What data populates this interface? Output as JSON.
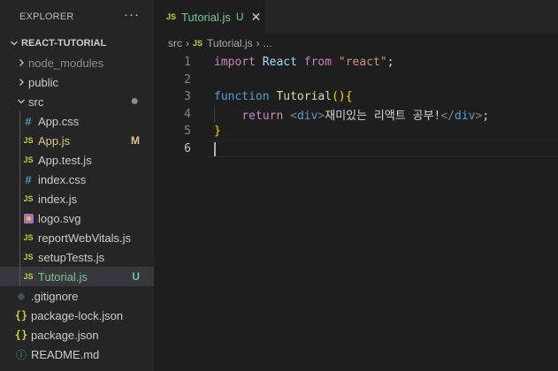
{
  "explorer": {
    "title": "EXPLORER",
    "more": "···",
    "root": "REACT-TUTORIAL",
    "items": [
      {
        "label": "node_modules",
        "kind": "folder",
        "open": false,
        "dim": true,
        "depth": 1
      },
      {
        "label": "public",
        "kind": "folder",
        "open": false,
        "depth": 1
      },
      {
        "label": "src",
        "kind": "folder",
        "open": true,
        "depth": 1,
        "badge": "●",
        "badge_kind": "dot"
      },
      {
        "label": "App.css",
        "kind": "css",
        "depth": 2
      },
      {
        "label": "App.js",
        "kind": "js",
        "depth": 2,
        "status": "mod",
        "badge": "M",
        "badge_kind": "mod"
      },
      {
        "label": "App.test.js",
        "kind": "js",
        "depth": 2
      },
      {
        "label": "index.css",
        "kind": "css",
        "depth": 2
      },
      {
        "label": "index.js",
        "kind": "js",
        "depth": 2
      },
      {
        "label": "logo.svg",
        "kind": "svg",
        "depth": 2
      },
      {
        "label": "reportWebVitals.js",
        "kind": "js",
        "depth": 2
      },
      {
        "label": "setupTests.js",
        "kind": "js",
        "depth": 2
      },
      {
        "label": "Tutorial.js",
        "kind": "js",
        "depth": 2,
        "status": "new",
        "badge": "U",
        "badge_kind": "new",
        "selected": true
      },
      {
        "label": ".gitignore",
        "kind": "git",
        "depth": 1
      },
      {
        "label": "package-lock.json",
        "kind": "json",
        "depth": 1
      },
      {
        "label": "package.json",
        "kind": "json",
        "depth": 1
      },
      {
        "label": "README.md",
        "kind": "md",
        "depth": 1
      }
    ]
  },
  "tab": {
    "icon": "JS",
    "name": "Tutorial.js",
    "status": "U",
    "close": "✕"
  },
  "breadcrumb": {
    "folder": "src",
    "icon": "JS",
    "file": "Tutorial.js",
    "rest": "..."
  },
  "editor": {
    "active_line": 6,
    "lines": [
      {
        "n": "1",
        "tokens": [
          [
            "k",
            "import"
          ],
          [
            "p",
            " "
          ],
          [
            "v",
            "React"
          ],
          [
            "p",
            " "
          ],
          [
            "k",
            "from"
          ],
          [
            "p",
            " "
          ],
          [
            "s",
            "\"react\""
          ],
          [
            "p",
            ";"
          ]
        ]
      },
      {
        "n": "2",
        "tokens": []
      },
      {
        "n": "3",
        "tokens": [
          [
            "kb",
            "function"
          ],
          [
            "p",
            " "
          ],
          [
            "f",
            "Tutorial"
          ],
          [
            "br1",
            "()"
          ],
          [
            "br1",
            "{"
          ]
        ]
      },
      {
        "n": "4",
        "tokens": [
          [
            "p",
            "    "
          ],
          [
            "k",
            "return"
          ],
          [
            "p",
            " "
          ],
          [
            "tg",
            "<"
          ],
          [
            "tn",
            "div"
          ],
          [
            "tg",
            ">"
          ],
          [
            "p",
            "재미있는 리액트 공부!"
          ],
          [
            "tg",
            "</"
          ],
          [
            "tn",
            "div"
          ],
          [
            "tg",
            ">"
          ],
          [
            "p",
            ";"
          ]
        ]
      },
      {
        "n": "5",
        "tokens": [
          [
            "br1",
            "}"
          ]
        ]
      },
      {
        "n": "6",
        "tokens": []
      }
    ]
  }
}
